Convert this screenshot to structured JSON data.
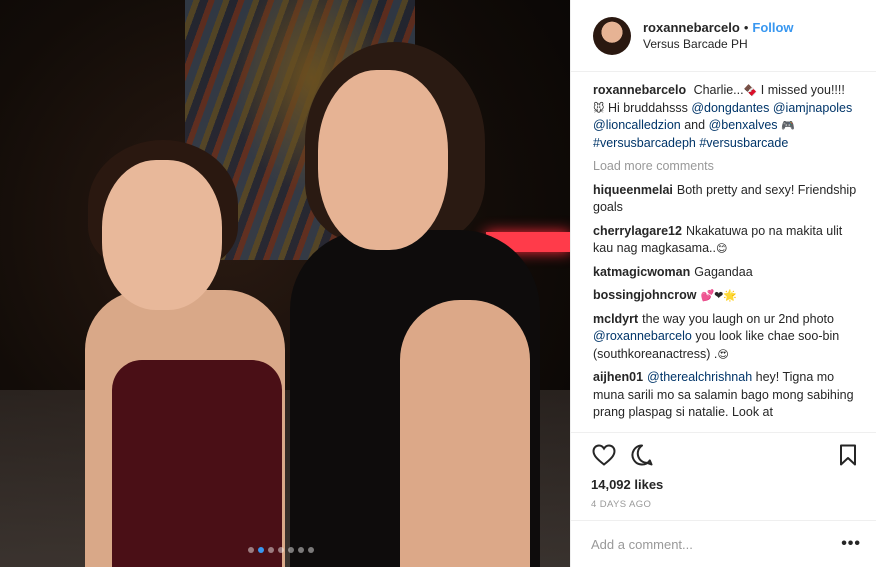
{
  "post": {
    "username": "roxannebarcelo",
    "separator": "•",
    "follow_label": "Follow",
    "location": "Versus Barcade PH",
    "carousel": {
      "count": 7,
      "active": 2
    }
  },
  "caption": {
    "user": "roxannebarcelo",
    "parts": [
      {
        "t": "Charlie..."
      },
      {
        "e": "🍫"
      },
      {
        "t": " I missed you!!!! "
      },
      {
        "e": "🐭"
      },
      {
        "t": " Hi bruddahsss "
      },
      {
        "m": "@dongdantes"
      },
      {
        "t": " "
      },
      {
        "m": "@iamjnapoles"
      },
      {
        "t": " "
      },
      {
        "m": "@lioncalledzion"
      },
      {
        "t": " and "
      },
      {
        "m": "@benxalves"
      },
      {
        "t": " "
      },
      {
        "e": "🎮"
      },
      {
        "t": " "
      },
      {
        "m": "#versusbarcadeph"
      },
      {
        "t": " "
      },
      {
        "m": "#versusbarcade"
      }
    ]
  },
  "load_more_label": "Load more comments",
  "comments": [
    {
      "user": "hiqueenmelai",
      "parts": [
        {
          "t": "Both pretty and sexy! Friendship goals"
        }
      ]
    },
    {
      "user": "cherrylagare12",
      "parts": [
        {
          "t": "Nkakatuwa po na makita ulit kau nag magkasama.."
        },
        {
          "e": "😊"
        }
      ]
    },
    {
      "user": "katmagicwoman",
      "parts": [
        {
          "t": "Gagandaa"
        }
      ]
    },
    {
      "user": "bossingjohncrow",
      "parts": [
        {
          "e": "💕❤🌟"
        }
      ]
    },
    {
      "user": "mcldyrt",
      "parts": [
        {
          "t": "the way you laugh on ur 2nd photo "
        },
        {
          "m": "@roxannebarcelo"
        },
        {
          "t": " you look like chae soo-bin (southkoreanactress) ."
        },
        {
          "e": "😍"
        }
      ]
    },
    {
      "user": "aijhen01",
      "parts": [
        {
          "m": "@therealchrishnah"
        },
        {
          "t": " hey! Tigna mo muna sarili mo sa salamin bago mong sabihing prang plaspag si natalie. Look at"
        }
      ]
    }
  ],
  "actions": {
    "likes": "14,092 likes",
    "date": "4 DAYS AGO"
  },
  "add_comment": {
    "placeholder": "Add a comment...",
    "more_label": "•••"
  },
  "colors": {
    "accent": "#3897f0",
    "text": "#262626",
    "muted": "#999999",
    "mention": "#003569"
  }
}
